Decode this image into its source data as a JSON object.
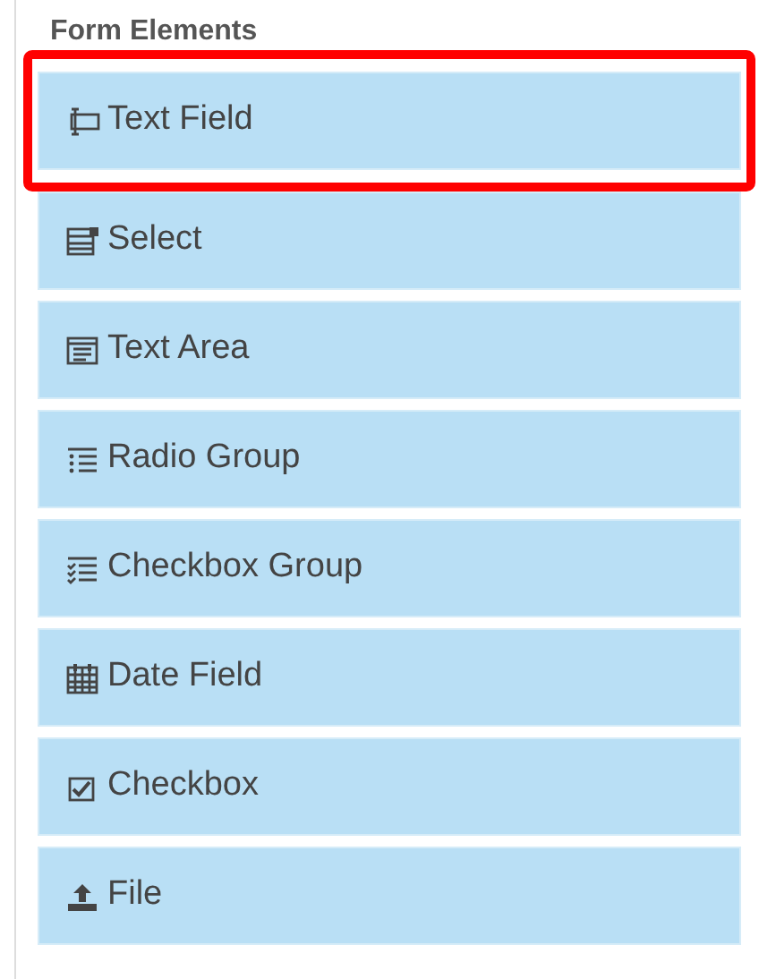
{
  "panel": {
    "title": "Form Elements"
  },
  "items": [
    {
      "kind": "textfield",
      "label": "Text Field",
      "highlighted": true
    },
    {
      "kind": "select",
      "label": "Select",
      "highlighted": false
    },
    {
      "kind": "textarea",
      "label": "Text Area",
      "highlighted": false
    },
    {
      "kind": "radio",
      "label": "Radio Group",
      "highlighted": false
    },
    {
      "kind": "checkgroup",
      "label": "Checkbox Group",
      "highlighted": false
    },
    {
      "kind": "date",
      "label": "Date Field",
      "highlighted": false
    },
    {
      "kind": "checkbox",
      "label": "Checkbox",
      "highlighted": false
    },
    {
      "kind": "file",
      "label": "File",
      "highlighted": false
    }
  ]
}
